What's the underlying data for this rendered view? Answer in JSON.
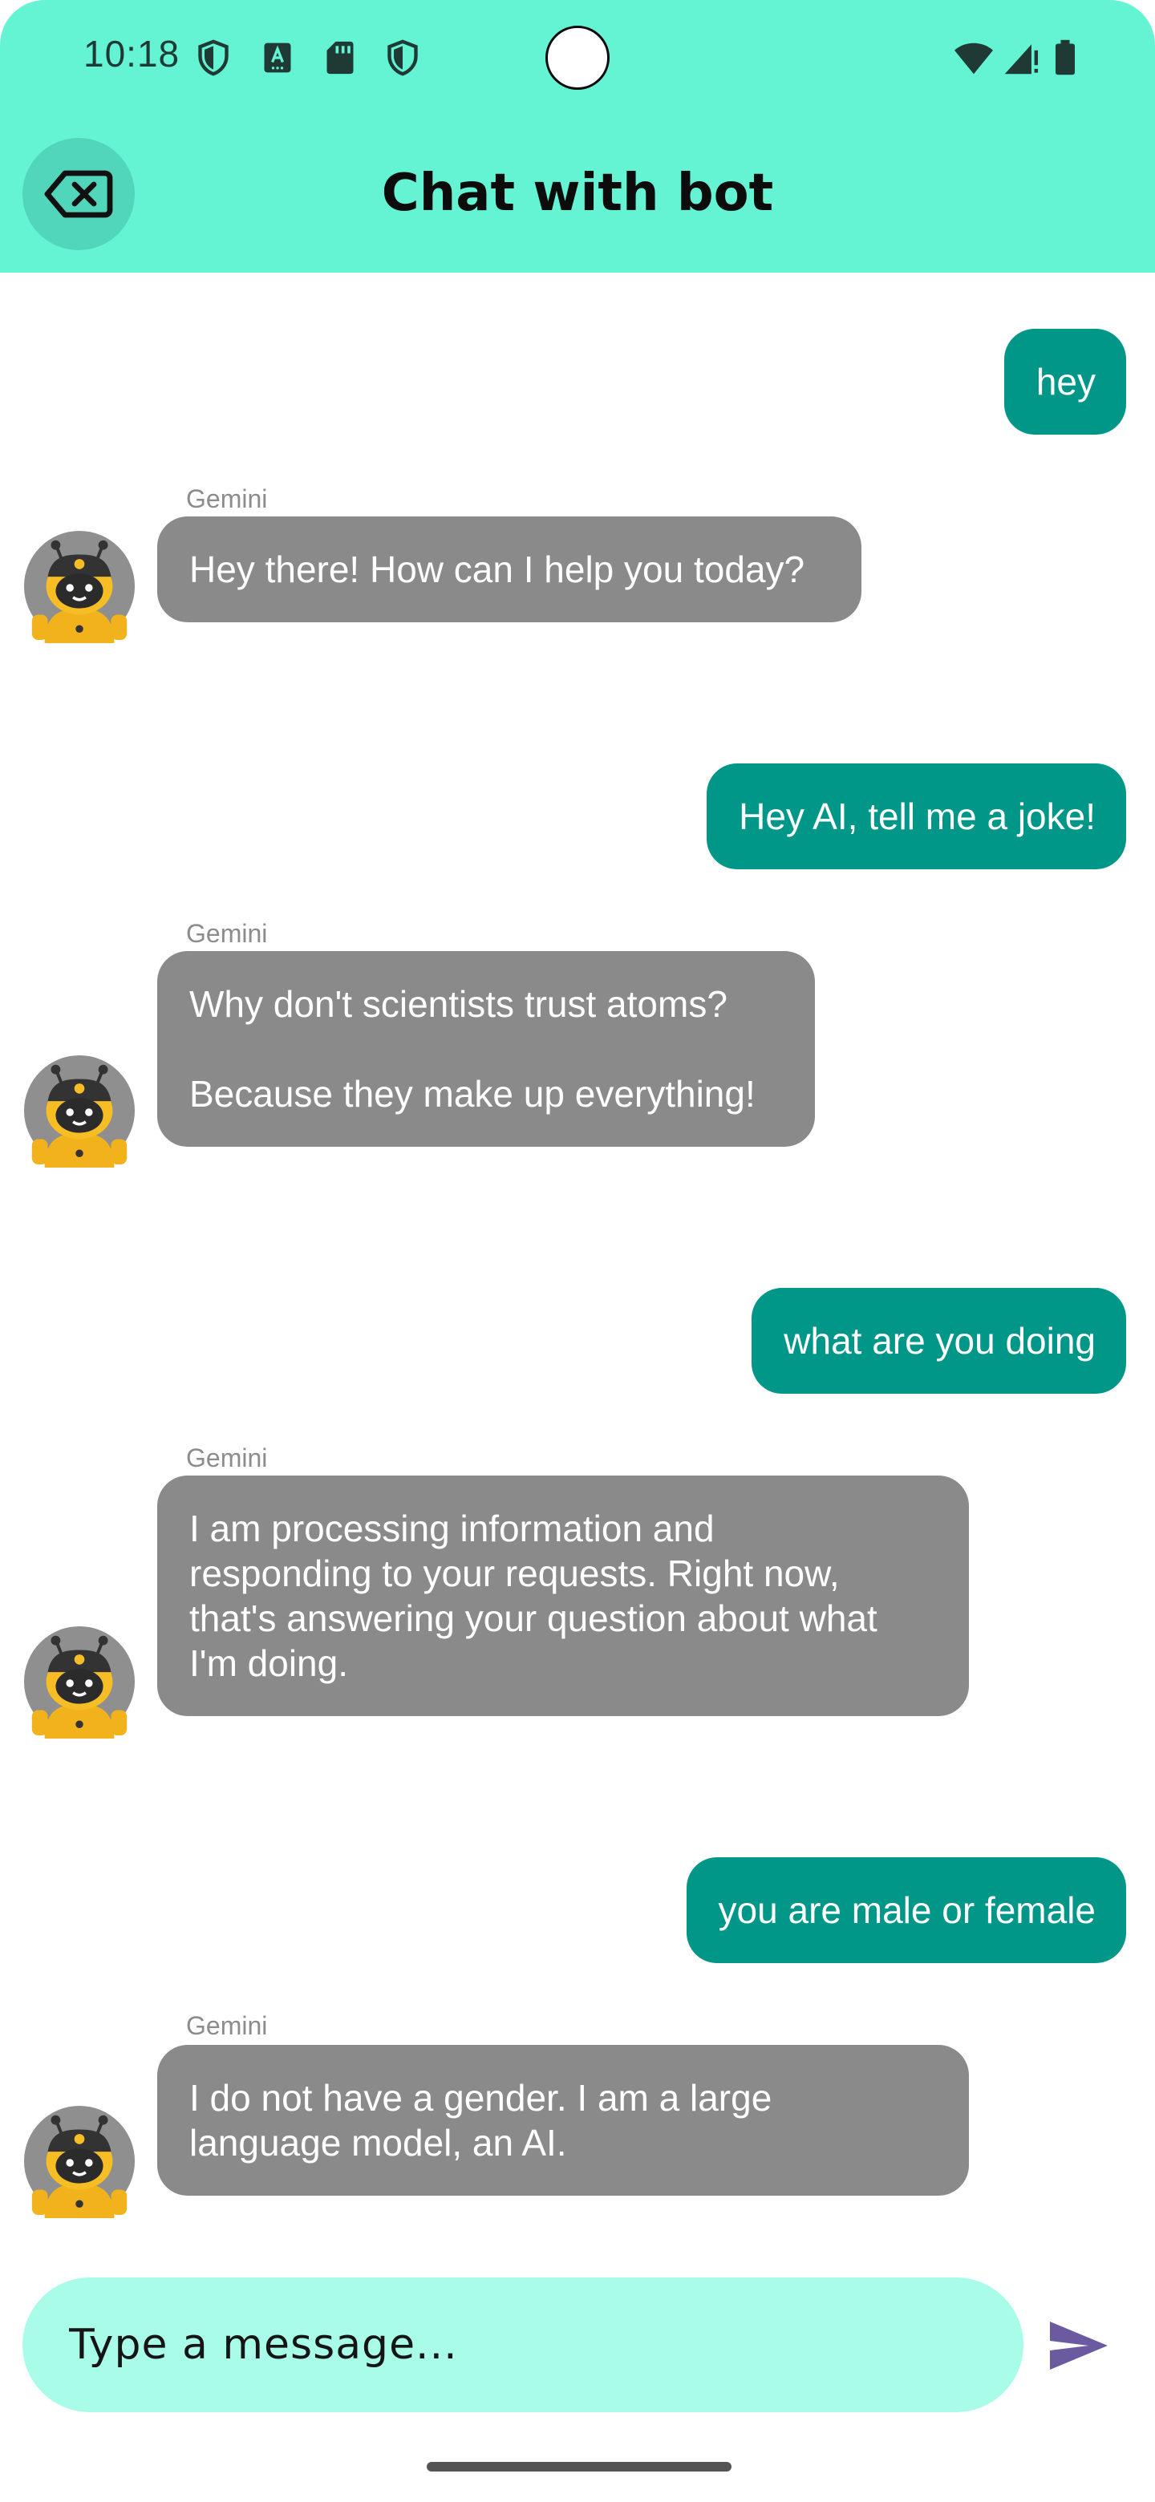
{
  "status_bar": {
    "time": "10:18",
    "left_icons": [
      "shield-icon",
      "keyboard-a-icon",
      "sd-card-icon",
      "shield-icon"
    ],
    "right_icons": [
      "wifi-icon",
      "cell-signal-icon",
      "battery-icon"
    ]
  },
  "app_bar": {
    "title": "Chat with bot",
    "back_icon": "backspace-x-icon",
    "background_color": "#64f4d4"
  },
  "messages": [
    {
      "role": "user",
      "text": "hey"
    },
    {
      "role": "bot",
      "sender": "Gemini",
      "text": "Hey there! How can I help you today?\n "
    },
    {
      "role": "user",
      "text": "Hey AI, tell me a joke!"
    },
    {
      "role": "bot",
      "sender": "Gemini",
      "text": "Why don't scientists trust atoms?\n\nBecause they make up everything!\n "
    },
    {
      "role": "user",
      "text": "what are you doing"
    },
    {
      "role": "bot",
      "sender": "Gemini",
      "text": "I am processing information and\nresponding to your requests.  Right now,\nthat's answering your question about what\nI'm doing.\n "
    },
    {
      "role": "user",
      "text": "you are male or female"
    },
    {
      "role": "bot",
      "sender": "Gemini",
      "text": "I do not have a gender.  I am a large\nlanguage model, an AI.\n "
    }
  ],
  "composer": {
    "placeholder": "Type a message...",
    "value": "",
    "send_icon": "send-arrow-icon"
  },
  "colors": {
    "user_bubble": "#009688",
    "bot_bubble": "#8a8a8a",
    "composer": "#a8fce8",
    "send_icon": "#6b5aa0"
  }
}
